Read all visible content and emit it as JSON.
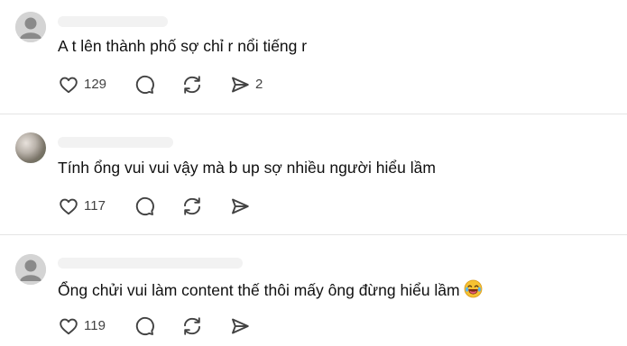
{
  "posts": [
    {
      "text": "A t lên thành phố sợ chỉ r nổi tiếng r",
      "likes": "129",
      "shares": "2",
      "avatar": "default-avatar-icon"
    },
    {
      "text": "Tính ổng vui vui vậy mà b up sợ nhiều người hiểu lầm",
      "likes": "117",
      "shares": "",
      "avatar": "photo-avatar"
    },
    {
      "text": "Ổng chửi vui làm content thế thôi mấy ông đừng hiểu lầm",
      "emoji": "😂",
      "likes": "119",
      "shares": "",
      "avatar": "default-avatar-icon"
    }
  ],
  "icons": {
    "like": "heart-icon",
    "reply": "comment-bubble-icon",
    "repost": "repost-icon",
    "share": "send-icon"
  },
  "colors": {
    "text": "#101010",
    "icon": "#424242",
    "divider": "#e5e5e5"
  }
}
